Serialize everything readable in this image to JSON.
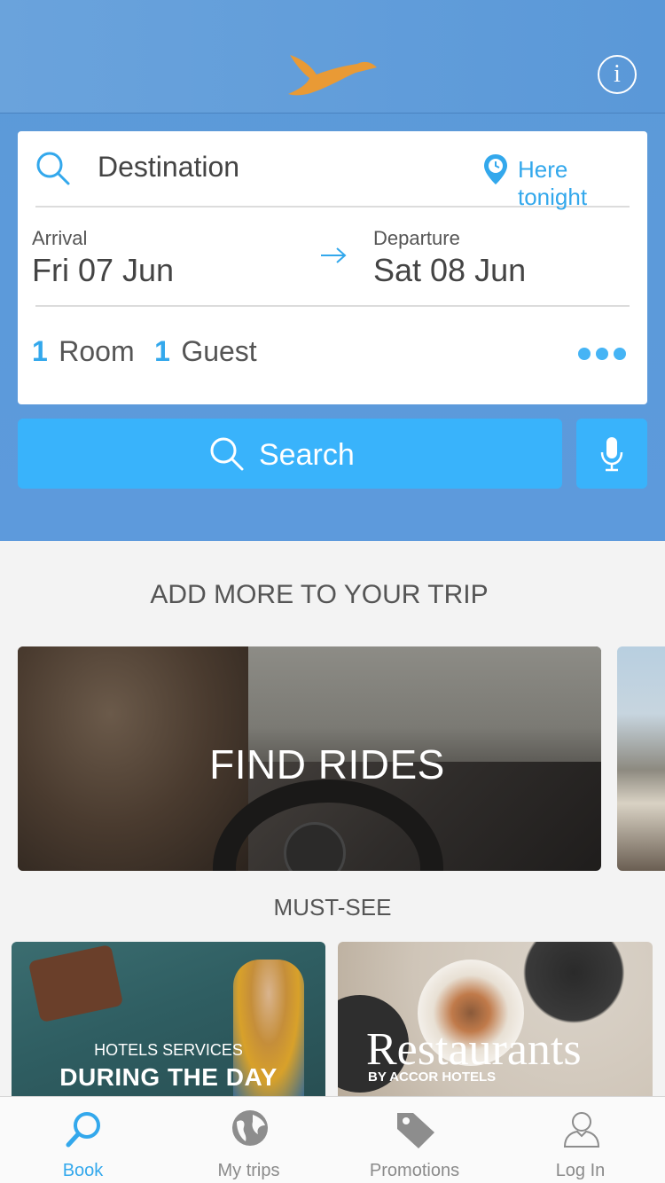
{
  "header": {
    "info_glyph": "i"
  },
  "search": {
    "destination_placeholder": "Destination",
    "here_tonight": "Here tonight",
    "arrival_label": "Arrival",
    "arrival_date": "Fri 07 Jun",
    "departure_label": "Departure",
    "departure_date": "Sat 08 Jun",
    "rooms_count": "1",
    "rooms_label": "Room",
    "guests_count": "1",
    "guests_label": "Guest",
    "search_button": "Search"
  },
  "content": {
    "add_more_title": "ADD MORE TO YOUR TRIP",
    "find_rides": "FIND RIDES",
    "must_see_title": "MUST-SEE",
    "hotels_services_small": "HOTELS SERVICES",
    "hotels_services_big": "DURING THE DAY",
    "restaurants_big": "Restaurants",
    "restaurants_small": "BY ACCOR HOTELS"
  },
  "tabs": [
    {
      "label": "Book",
      "icon": "search-icon",
      "active": true
    },
    {
      "label": "My trips",
      "icon": "globe-icon",
      "active": false
    },
    {
      "label": "Promotions",
      "icon": "tag-icon",
      "active": false
    },
    {
      "label": "Log In",
      "icon": "user-icon",
      "active": false
    }
  ],
  "colors": {
    "accent": "#33a8ec",
    "header_blue": "#5b9ad8",
    "button_blue": "#39b3fb",
    "logo_orange": "#e99a35"
  }
}
